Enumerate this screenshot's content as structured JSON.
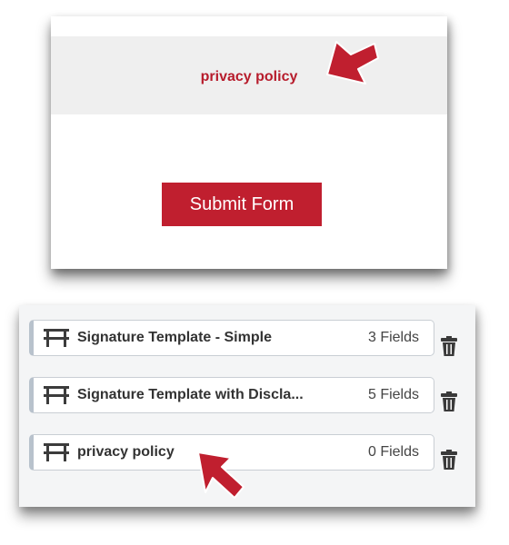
{
  "form_preview": {
    "privacy_link": "privacy policy",
    "submit_label": "Submit Form"
  },
  "templates": [
    {
      "name": "Signature Template - Simple",
      "count": "3 Fields"
    },
    {
      "name": "Signature Template with Discla...",
      "count": "5 Fields"
    },
    {
      "name": "privacy policy",
      "count": "0 Fields"
    }
  ],
  "icons": {
    "template": "h-bar-icon",
    "delete": "trash-icon",
    "pointer": "red-arrow-icon"
  },
  "colors": {
    "accent_red": "#c01f2f",
    "link_red": "#b71c2c",
    "band_gray": "#efefef"
  }
}
